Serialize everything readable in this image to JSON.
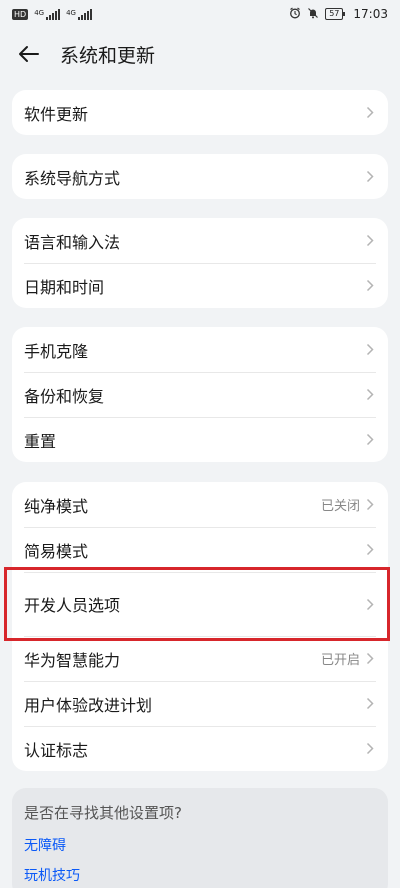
{
  "status": {
    "hd_badge": "HD",
    "sim1_type": "4G",
    "sim2_type": "4G",
    "battery": "57",
    "time": "17:03"
  },
  "header": {
    "title": "系统和更新"
  },
  "groups": [
    {
      "items": [
        {
          "label": "软件更新"
        }
      ]
    },
    {
      "items": [
        {
          "label": "系统导航方式"
        }
      ]
    },
    {
      "items": [
        {
          "label": "语言和输入法"
        },
        {
          "label": "日期和时间"
        }
      ]
    },
    {
      "items": [
        {
          "label": "手机克隆"
        },
        {
          "label": "备份和恢复"
        },
        {
          "label": "重置"
        }
      ]
    },
    {
      "items": [
        {
          "label": "纯净模式",
          "value": "已关闭"
        },
        {
          "label": "简易模式"
        },
        {
          "label": "开发人员选项"
        },
        {
          "label": "华为智慧能力",
          "value": "已开启"
        },
        {
          "label": "用户体验改进计划"
        },
        {
          "label": "认证标志"
        }
      ]
    }
  ],
  "suggest": {
    "question": "是否在寻找其他设置项?",
    "links": [
      "无障碍",
      "玩机技巧"
    ]
  },
  "colors": {
    "accent": "#0a59f7",
    "highlight": "#d7262b",
    "background": "#f1f3f5"
  }
}
